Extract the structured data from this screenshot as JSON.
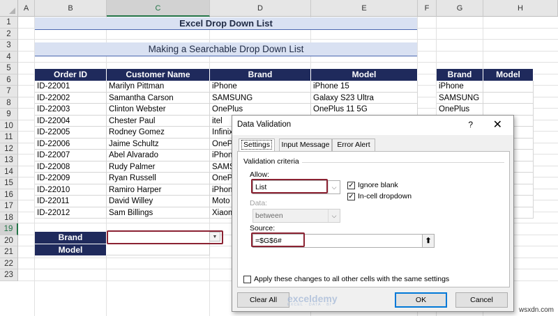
{
  "columns": [
    "A",
    "B",
    "C",
    "D",
    "E",
    "F",
    "G",
    "H"
  ],
  "rows": [
    "1",
    "2",
    "3",
    "4",
    "5",
    "6",
    "7",
    "8",
    "9",
    "10",
    "11",
    "12",
    "13",
    "14",
    "15",
    "16",
    "17",
    "18",
    "19",
    "20",
    "21",
    "22",
    "23"
  ],
  "title_main": "Excel Drop Down List",
  "title_sub": "Making a Searchable Drop Down List",
  "table": {
    "headers": [
      "Order ID",
      "Customer Name",
      "Brand",
      "Model"
    ],
    "rows": [
      [
        "ID-22001",
        "Marilyn Pittman",
        "iPhone",
        "iPhone 15"
      ],
      [
        "ID-22002",
        "Samantha Carson",
        "SAMSUNG",
        "Galaxy S23 Ultra"
      ],
      [
        "ID-22003",
        "Clinton Webster",
        "OnePlus",
        "OnePlus 11 5G"
      ],
      [
        "ID-22004",
        "Chester Paul",
        "itel",
        ""
      ],
      [
        "ID-22005",
        "Rodney Gomez",
        "Infinix",
        ""
      ],
      [
        "ID-22006",
        "Jaime Schultz",
        "OneP",
        ""
      ],
      [
        "ID-22007",
        "Abel Alvarado",
        "iPhon",
        ""
      ],
      [
        "ID-22008",
        "Rudy Palmer",
        "SAMS",
        ""
      ],
      [
        "ID-22009",
        "Ryan Russell",
        "OneP",
        ""
      ],
      [
        "ID-22010",
        "Ramiro Harper",
        "iPhon",
        ""
      ],
      [
        "ID-22011",
        "David Willey",
        "Moto",
        ""
      ],
      [
        "ID-22012",
        "Sam Billings",
        "Xiaom",
        ""
      ]
    ]
  },
  "side_table": {
    "headers": [
      "Brand",
      "Model"
    ],
    "brands": [
      "iPhone",
      "SAMSUNG",
      "OnePlus"
    ]
  },
  "lookup": {
    "brand_label": "Brand",
    "model_label": "Model"
  },
  "dialog": {
    "title": "Data Validation",
    "help": "?",
    "close": "✕",
    "tabs": [
      "Settings",
      "Input Message",
      "Error Alert"
    ],
    "section": "Validation criteria",
    "allow_label": "Allow:",
    "allow_value": "List",
    "data_label": "Data:",
    "data_value": "between",
    "ignore_blank": "Ignore blank",
    "incell_dropdown": "In-cell dropdown",
    "source_label": "Source:",
    "source_value": "=$G$6#",
    "apply_all": "Apply these changes to all other cells with the same settings",
    "clear_all": "Clear All",
    "ok": "OK",
    "cancel": "Cancel"
  },
  "watermark": {
    "brand": "exceldemy",
    "tagline": "EXCEL · DATA · BI"
  },
  "site": "wsxdn.com",
  "colors": {
    "header_navy": "#1f2a5c",
    "title_band": "#d9e1f2",
    "highlight": "#8b2232",
    "excel_green": "#217346"
  }
}
